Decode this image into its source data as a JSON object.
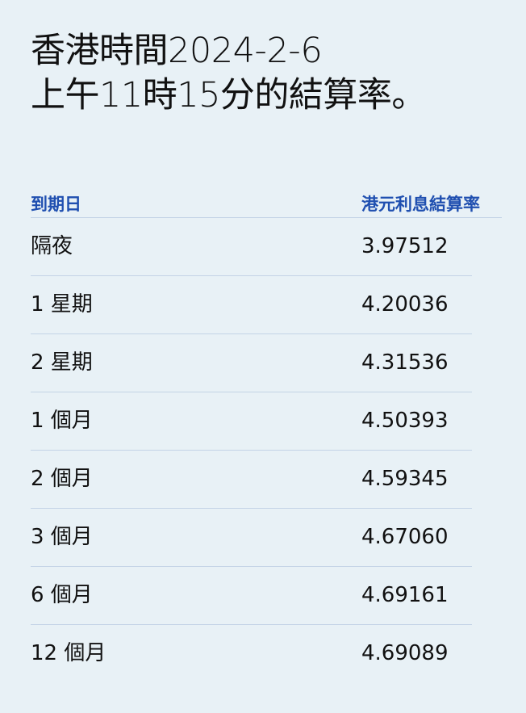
{
  "heading": {
    "line1": "香港時間2024-2-6",
    "line2": "上午11時15分的結算率。"
  },
  "table": {
    "headers": {
      "tenor": "到期日",
      "rate": "港元利息結算率"
    },
    "rows": [
      {
        "tenor": "隔夜",
        "rate": "3.97512"
      },
      {
        "tenor": "1 星期",
        "rate": "4.20036"
      },
      {
        "tenor": "2 星期",
        "rate": "4.31536"
      },
      {
        "tenor": "1 個月",
        "rate": "4.50393"
      },
      {
        "tenor": "2 個月",
        "rate": "4.59345"
      },
      {
        "tenor": "3 個月",
        "rate": "4.67060"
      },
      {
        "tenor": "6 個月",
        "rate": "4.69161"
      },
      {
        "tenor": "12 個月",
        "rate": "4.69089"
      }
    ]
  },
  "colors": {
    "background": "#e8f1f6",
    "header_text": "#1f4fb0",
    "divider": "#c3d3e6",
    "body_text": "#111111"
  }
}
